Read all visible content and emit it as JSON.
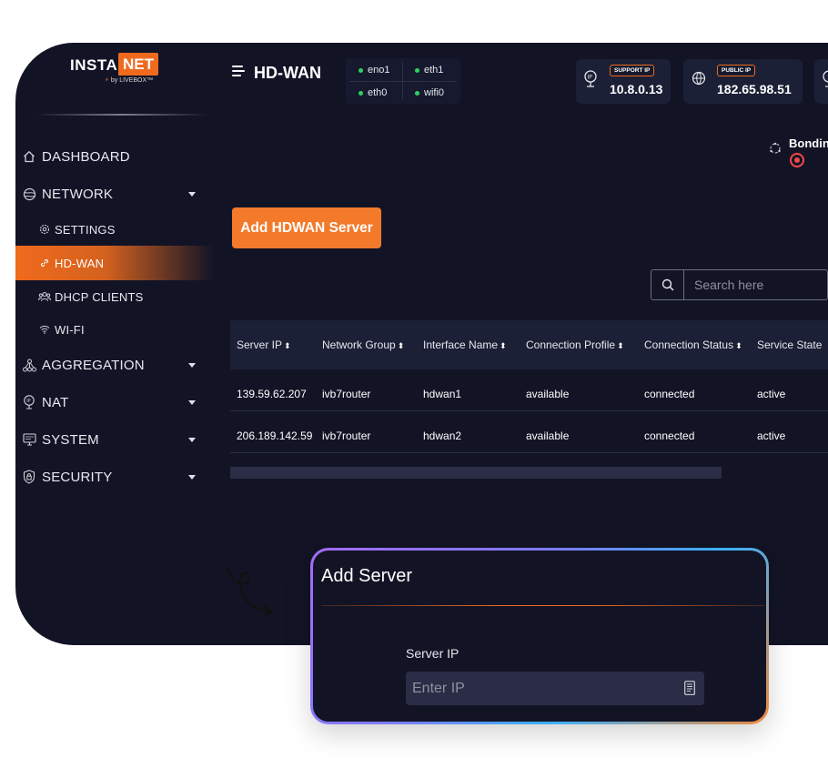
{
  "brand": {
    "insta": "INSTA",
    "net": "NET",
    "by": "by LIVEBOX™"
  },
  "sidebar": {
    "items": [
      {
        "label": "DASHBOARD",
        "icon": "home-icon"
      },
      {
        "label": "NETWORK",
        "icon": "globe-icon",
        "expanded": true
      },
      {
        "label": "SETTINGS",
        "icon": "gear-icon",
        "sub": true
      },
      {
        "label": "HD-WAN",
        "icon": "link-icon",
        "sub": true,
        "active": true
      },
      {
        "label": "DHCP CLIENTS",
        "icon": "users-icon",
        "sub": true
      },
      {
        "label": "WI-FI",
        "icon": "wifi-icon",
        "sub": true
      },
      {
        "label": "AGGREGATION",
        "icon": "network-tree-icon"
      },
      {
        "label": "NAT",
        "icon": "ip-pin-icon"
      },
      {
        "label": "SYSTEM",
        "icon": "monitor-icon"
      },
      {
        "label": "SECURITY",
        "icon": "lock-icon"
      }
    ]
  },
  "header": {
    "title": "HD-WAN",
    "interfaces": [
      {
        "name": "eno1",
        "status": "up",
        "color": "#2fd062"
      },
      {
        "name": "eth1",
        "status": "up",
        "color": "#2fd062"
      },
      {
        "name": "eth0",
        "status": "up",
        "color": "#2fd062"
      },
      {
        "name": "wifi0",
        "status": "up",
        "color": "#2fd062"
      }
    ],
    "support_ip": {
      "badge": "SUPPORT IP",
      "value": "10.8.0.13"
    },
    "public_ip": {
      "badge": "PUBLIC IP",
      "value": "182.65.98.51"
    },
    "bonding": {
      "label": "Bondin",
      "status_color": "#f24848"
    }
  },
  "actions": {
    "add_server": "Add HDWAN Server"
  },
  "search": {
    "placeholder": "Search here",
    "value": ""
  },
  "table": {
    "columns": [
      "Server IP",
      "Network Group",
      "Interface Name",
      "Connection Profile",
      "Connection Status",
      "Service State"
    ],
    "rows": [
      [
        "139.59.62.207",
        "ivb7router",
        "hdwan1",
        "available",
        "connected",
        "active"
      ],
      [
        "206.189.142.59",
        "ivb7router",
        "hdwan2",
        "available",
        "connected",
        "active"
      ]
    ]
  },
  "modal": {
    "title": "Add Server",
    "field_label": "Server IP",
    "field_placeholder": "Enter IP",
    "field_value": ""
  },
  "colors": {
    "accent": "#f06a1d",
    "background": "#121426",
    "online": "#2fd062",
    "alert": "#f24848"
  }
}
